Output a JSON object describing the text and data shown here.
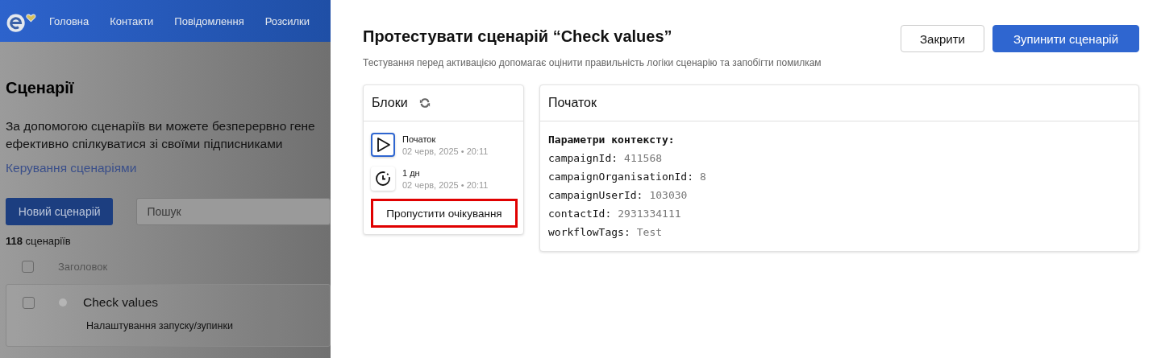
{
  "nav": {
    "items": [
      {
        "label": "Головна"
      },
      {
        "label": "Контакти"
      },
      {
        "label": "Повідомлення"
      },
      {
        "label": "Розсилки"
      }
    ]
  },
  "page": {
    "title": "Сценарії",
    "description_lines": [
      "За допомогою сценаріїв ви можете безперервно гене",
      "ефективно спілкуватися зі своїми підписниками"
    ],
    "link": "Керування сценаріями",
    "new_button": "Новий сценарій",
    "search": {
      "placeholder": "Пошук"
    },
    "count": "**118** сценаріїв",
    "table": {
      "header": {
        "label": "Заголовок",
        "checked": false
      },
      "rows": [
        {
          "name": "Check values",
          "checked": false,
          "color": "#b5b5b5",
          "subtitle": "Налаштування запуску/зупинки"
        }
      ]
    }
  },
  "dialog": {
    "title": "Протестувати сценарій “Check values”",
    "subtitle": "Тестування перед активацією допомагає оцінити правильність логіки сценарію та запобігти помилкам",
    "buttons": [
      {
        "label": "Закрити",
        "kind": "secondary"
      },
      {
        "label": "Зупинити сценарій",
        "kind": "primary"
      }
    ],
    "blocks": {
      "title": "Блоки",
      "items": [
        {
          "kind": "start",
          "name": "Початок",
          "time": "02 черв, 2025 • 20:11",
          "selected": true
        },
        {
          "kind": "delay",
          "name": "1 дн",
          "time": "02 черв, 2025 • 20:11",
          "selected": false
        }
      ],
      "action": {
        "label": "Пропустити очікування",
        "highlighted": true
      }
    },
    "details": {
      "title": "Початок",
      "heading": "Параметри контексту:",
      "params": [
        {
          "key": "campaignId:",
          "value": "411568"
        },
        {
          "key": "campaignOrganisationId:",
          "value": "8"
        },
        {
          "key": "campaignUserId:",
          "value": "103030"
        },
        {
          "key": "contactId:",
          "value": "2931334111"
        },
        {
          "key": "workflowTags:",
          "value": "Test"
        }
      ]
    }
  }
}
